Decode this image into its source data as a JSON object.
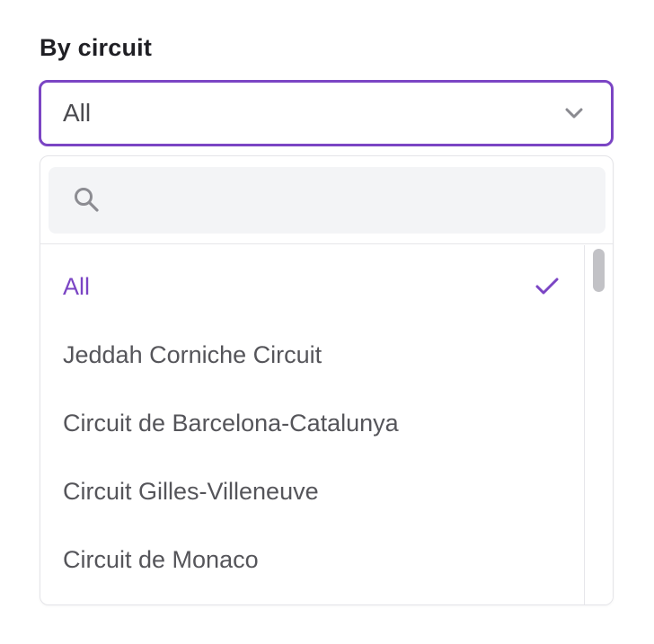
{
  "filter": {
    "label": "By circuit",
    "selected_value": "All"
  },
  "search": {
    "placeholder": "",
    "value": ""
  },
  "options": [
    {
      "label": "All",
      "selected": true
    },
    {
      "label": "Jeddah Corniche Circuit",
      "selected": false
    },
    {
      "label": "Circuit de Barcelona-Catalunya",
      "selected": false
    },
    {
      "label": "Circuit Gilles-Villeneuve",
      "selected": false
    },
    {
      "label": "Circuit de Monaco",
      "selected": false
    }
  ],
  "icons": {
    "chevron": "chevron-down-icon",
    "search": "search-icon",
    "check": "check-icon"
  },
  "colors": {
    "accent": "#7b45c4",
    "text": "#55555a",
    "search_bg": "#f3f4f6"
  }
}
